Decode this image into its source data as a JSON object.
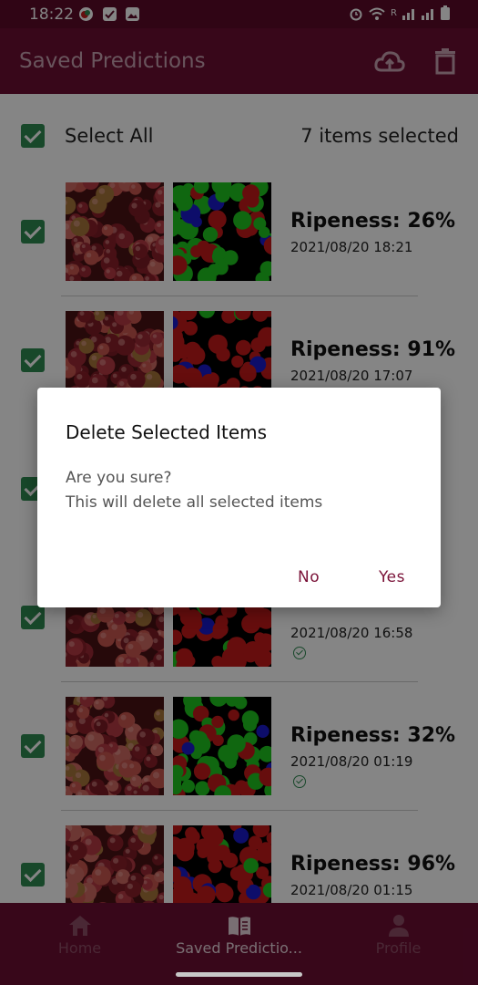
{
  "status_bar": {
    "time": "18:22",
    "network_label": "R"
  },
  "app_bar": {
    "title": "Saved Predictions",
    "upload_icon": "cloud-upload-icon",
    "delete_icon": "trash-icon"
  },
  "select_all": {
    "label": "Select All",
    "count_text": "7 items selected",
    "checked": true
  },
  "items": [
    {
      "ripeness": "Ripeness: 26%",
      "date": "2021/08/20 18:21",
      "mask": "green",
      "synced": false
    },
    {
      "ripeness": "Ripeness: 91%",
      "date": "2021/08/20 17:07",
      "mask": "red",
      "synced": true
    },
    {
      "ripeness": "",
      "date": "",
      "mask": "red",
      "synced": false
    },
    {
      "ripeness": "",
      "date": "2021/08/20 16:58",
      "mask": "red",
      "synced": true
    },
    {
      "ripeness": "Ripeness: 32%",
      "date": "2021/08/20 01:19",
      "mask": "green",
      "synced": true
    },
    {
      "ripeness": "Ripeness: 96%",
      "date": "2021/08/20 01:15",
      "mask": "red",
      "synced": true
    }
  ],
  "bottom_nav": {
    "items": [
      {
        "label": "Home",
        "icon": "home-icon",
        "active": false
      },
      {
        "label": "Saved Predictio...",
        "icon": "book-icon",
        "active": true
      },
      {
        "label": "Profile",
        "icon": "person-icon",
        "active": false
      }
    ]
  },
  "dialog": {
    "title": "Delete Selected Items",
    "message_line1": "Are you sure?",
    "message_line2": "This will delete all selected items",
    "no_label": "No",
    "yes_label": "Yes"
  },
  "colors": {
    "primary": "#6c0e33",
    "status_bar": "#5c0a2a",
    "checkbox": "#2f8a52",
    "dialog_button": "#7a1238"
  }
}
